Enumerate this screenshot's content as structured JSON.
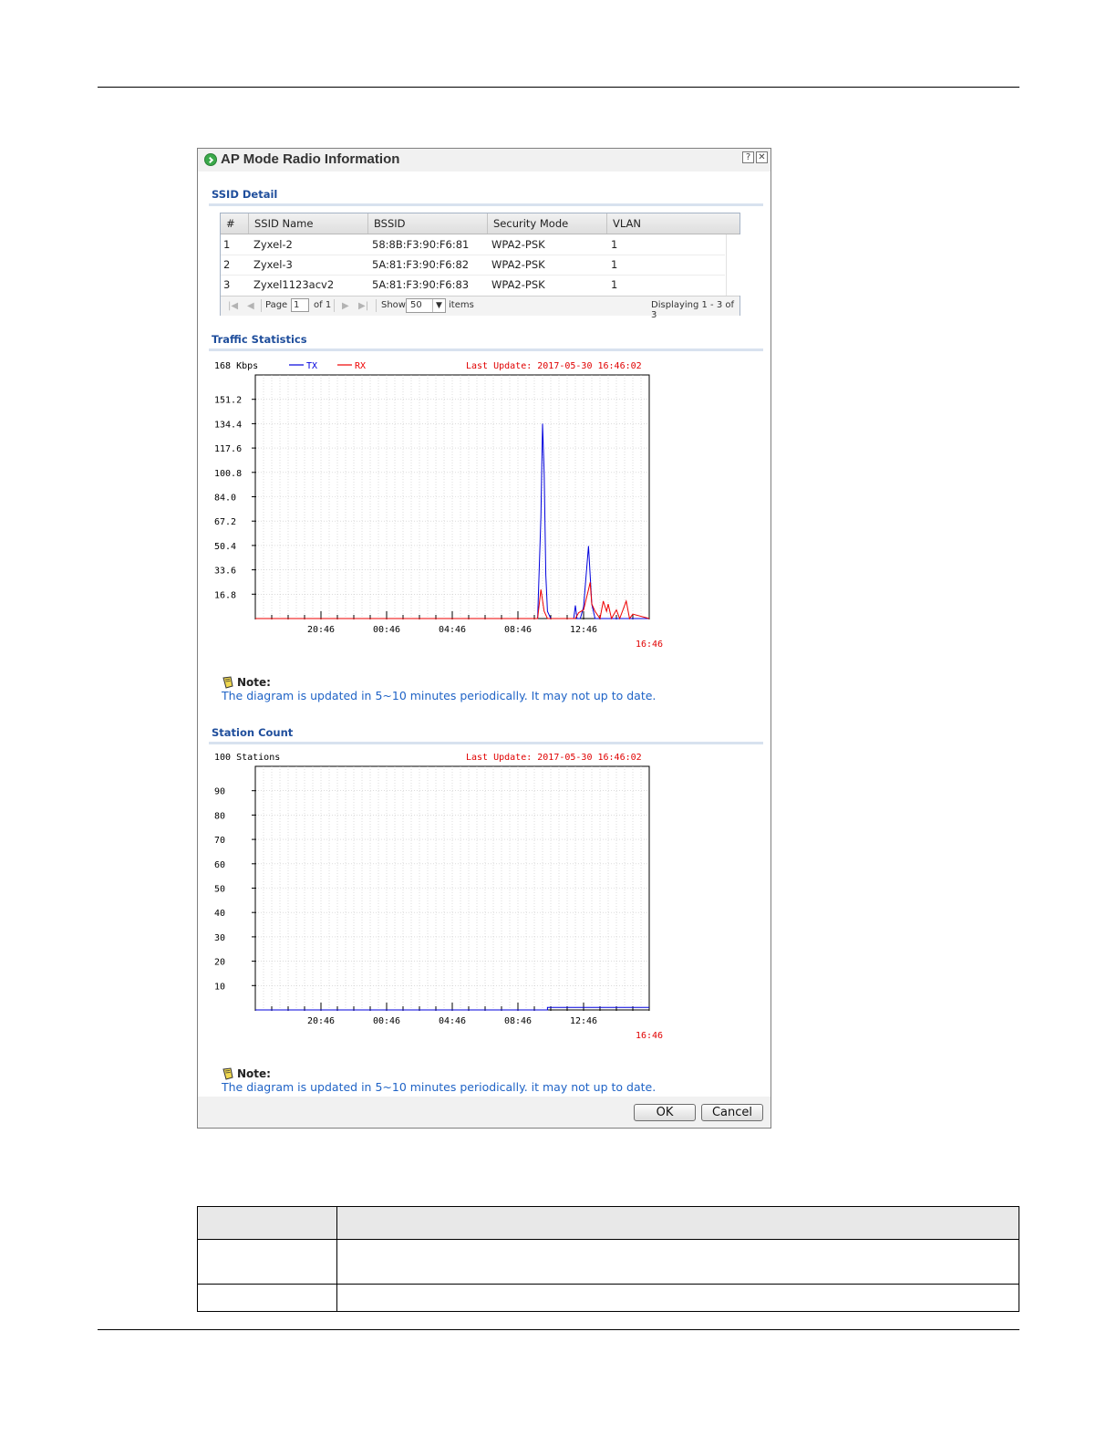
{
  "dialog": {
    "title": "AP Mode Radio Information",
    "help_label": "?",
    "close_label": "✕"
  },
  "ssid_detail": {
    "section_title": "SSID Detail",
    "columns": [
      "#",
      "SSID Name",
      "BSSID",
      "Security Mode",
      "VLAN"
    ],
    "rows": [
      {
        "num": "1",
        "ssid": "Zyxel-2",
        "bssid": "58:8B:F3:90:F6:81",
        "security": "WPA2-PSK",
        "vlan": "1"
      },
      {
        "num": "2",
        "ssid": "Zyxel-3",
        "bssid": "5A:81:F3:90:F6:82",
        "security": "WPA2-PSK",
        "vlan": "1"
      },
      {
        "num": "3",
        "ssid": "Zyxel1123acv2",
        "bssid": "5A:81:F3:90:F6:83",
        "security": "WPA2-PSK",
        "vlan": "1"
      }
    ],
    "pager": {
      "page_label": "Page",
      "page_value": "1",
      "of_label": "of 1",
      "show_label": "Show",
      "show_value": "50",
      "items_label": "items",
      "displaying": "Displaying 1 - 3 of 3"
    }
  },
  "traffic": {
    "section_title": "Traffic Statistics",
    "max_label": "168 Kbps",
    "last_update": "Last Update: 2017-05-30 16:46:02",
    "note_label": "Note:",
    "note_text": "The diagram is updated in 5~10 minutes periodically. It may not up to date.",
    "colors": {
      "tx": "#0000dd",
      "rx": "#ee0000"
    }
  },
  "station": {
    "section_title": "Station Count",
    "max_label": "100 Stations",
    "last_update": "Last Update: 2017-05-30 16:46:02",
    "note_label": "Note:",
    "note_text": "The diagram is updated in 5~10 minutes periodically. it may not up to date."
  },
  "buttons": {
    "ok": "OK",
    "cancel": "Cancel"
  },
  "chart_data": [
    {
      "type": "line",
      "title": "",
      "legend": [
        "TX",
        "RX"
      ],
      "y_ticks": [
        "151.2",
        "134.4",
        "117.6",
        "100.8",
        "84.0",
        "67.2",
        "50.4",
        "33.6",
        "16.8"
      ],
      "ylim": [
        0,
        168
      ],
      "x_ticks": [
        "20:46",
        "00:46",
        "04:46",
        "08:46",
        "12:46"
      ],
      "x_current": "16:46",
      "x_hours_range": [
        -24,
        0
      ],
      "series": [
        {
          "name": "TX",
          "x": [
            -24,
            -6.8,
            -6.6,
            -6.5,
            -6.4,
            -6.3,
            -6.2,
            -6.0,
            -5.0,
            -4.6,
            -4.5,
            -4.4,
            -4.2,
            -4.0,
            -3.7,
            -3.6,
            -3.5,
            -3.4,
            -3.3,
            -3.2,
            -3.0,
            -2.5,
            -2.0,
            -1.0,
            0
          ],
          "y": [
            0,
            0,
            70,
            134.4,
            100,
            30,
            5,
            0,
            0,
            0,
            9,
            0,
            0,
            8,
            50,
            30,
            10,
            5,
            0,
            0,
            0,
            0,
            0,
            0,
            0
          ]
        },
        {
          "name": "RX",
          "x": [
            -24,
            -6.8,
            -6.6,
            -6.4,
            -6.2,
            -6.0,
            -5.0,
            -4.5,
            -4.3,
            -4.0,
            -3.7,
            -3.6,
            -3.5,
            -3.3,
            -3.0,
            -2.8,
            -2.6,
            -2.5,
            -2.3,
            -2.0,
            -1.8,
            -1.4,
            -1.2,
            -1.0,
            0
          ],
          "y": [
            0,
            0,
            20,
            5,
            0,
            0,
            0,
            0,
            4,
            6,
            20,
            25,
            10,
            5,
            0,
            12,
            5,
            10,
            0,
            6,
            0,
            12,
            0,
            3,
            0
          ]
        }
      ]
    },
    {
      "type": "line",
      "title": "",
      "y_ticks": [
        "90",
        "80",
        "70",
        "60",
        "50",
        "40",
        "30",
        "20",
        "10"
      ],
      "ylim": [
        0,
        100
      ],
      "x_ticks": [
        "20:46",
        "00:46",
        "04:46",
        "08:46",
        "12:46"
      ],
      "x_current": "16:46",
      "x_hours_range": [
        -24,
        0
      ],
      "series": [
        {
          "name": "",
          "x": [
            -24,
            -6.2,
            -6.2,
            -4.2,
            0
          ],
          "y": [
            0,
            0,
            1,
            1,
            1
          ]
        }
      ]
    }
  ],
  "description_table": {
    "header_left": "",
    "header_right": ""
  }
}
